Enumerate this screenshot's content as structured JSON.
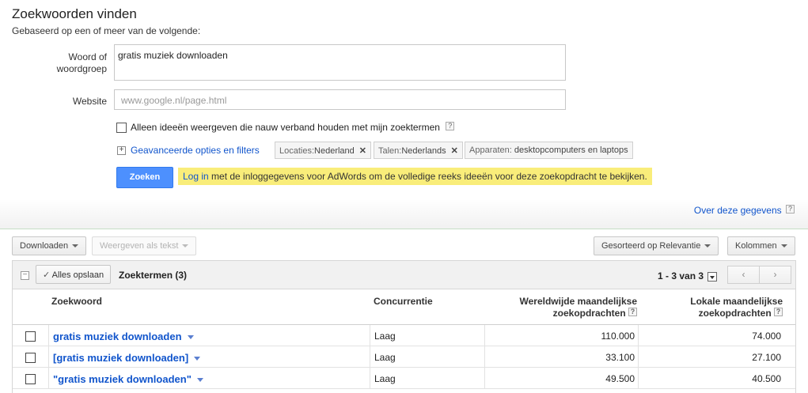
{
  "header": {
    "title": "Zoekwoorden vinden",
    "subtitle": "Gebaseerd op een of meer van de volgende:"
  },
  "form": {
    "keyword_label_line1": "Woord of",
    "keyword_label_line2": "woordgroep",
    "keyword_value": "gratis muziek downloaden",
    "website_label": "Website",
    "website_placeholder": "www.google.nl/page.html",
    "checkbox_label": "Alleen ideeën weergeven die nauw verband houden met mijn zoektermen",
    "help_glyph": "?",
    "advanced_link": "Geavanceerde opties en filters",
    "chips": [
      {
        "label": "Locaties:",
        "value": "Nederland",
        "removable": true
      },
      {
        "label": "Talen:",
        "value": "Nederlands",
        "removable": true
      },
      {
        "label": "Apparaten:",
        "value": "desktopcomputers en laptops",
        "removable": false
      }
    ],
    "search_button": "Zoeken",
    "notice_link": "Log in",
    "notice_text": " met de inloggegevens voor AdWords om de volledige reeks ideeën voor deze zoekopdracht te bekijken.",
    "notice_color": "#f9ed7a"
  },
  "about_link": "Over deze gegevens",
  "toolbar": {
    "download": "Downloaden",
    "view_as_text": "Weergeven als tekst",
    "sort": "Gesorteerd op Relevantie",
    "columns": "Kolommen"
  },
  "results": {
    "save_all": "Alles opslaan",
    "title": "Zoektermen (3)",
    "pager": "1 - 3 van 3",
    "prev": "‹",
    "next": "›",
    "columns": {
      "keyword": "Zoekwoord",
      "competition": "Concurrentie",
      "global_line1": "Wereldwijde maandelijkse",
      "global_line2": "zoekopdrachten",
      "local_line1": "Lokale maandelijkse",
      "local_line2": "zoekopdrachten"
    },
    "rows": [
      {
        "keyword": "gratis muziek downloaden",
        "competition": "Laag",
        "global": "110.000",
        "local": "74.000"
      },
      {
        "keyword": "[gratis muziek downloaden]",
        "competition": "Laag",
        "global": "33.100",
        "local": "27.100"
      },
      {
        "keyword": "\"gratis muziek downloaden\"",
        "competition": "Laag",
        "global": "49.500",
        "local": "40.500"
      }
    ]
  },
  "colors": {
    "link": "#1155cc",
    "primary_button": "#4d90fe"
  }
}
